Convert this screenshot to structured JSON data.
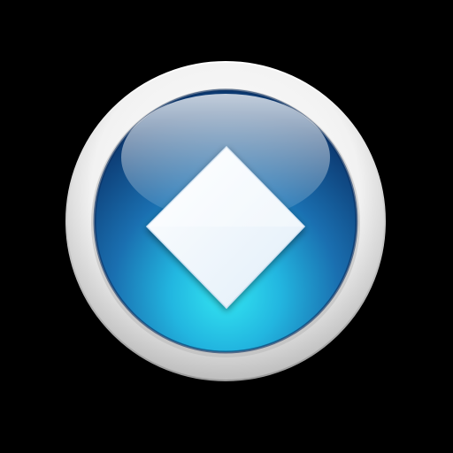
{
  "icon": {
    "name": "diamond-icon",
    "shape": "diamond",
    "style": "glossy round button"
  },
  "colors": {
    "background": "#000000",
    "ring_light": "#ffffff",
    "ring_shadow": "#c9c9c9",
    "orb_top": "#9fc0dc",
    "orb_mid": "#1f6fb0",
    "orb_deep": "#0d3f7a",
    "orb_glow": "#2fe3f0",
    "glyph": "#f4f9fd",
    "glyph_edge": "#dbe8f4"
  }
}
